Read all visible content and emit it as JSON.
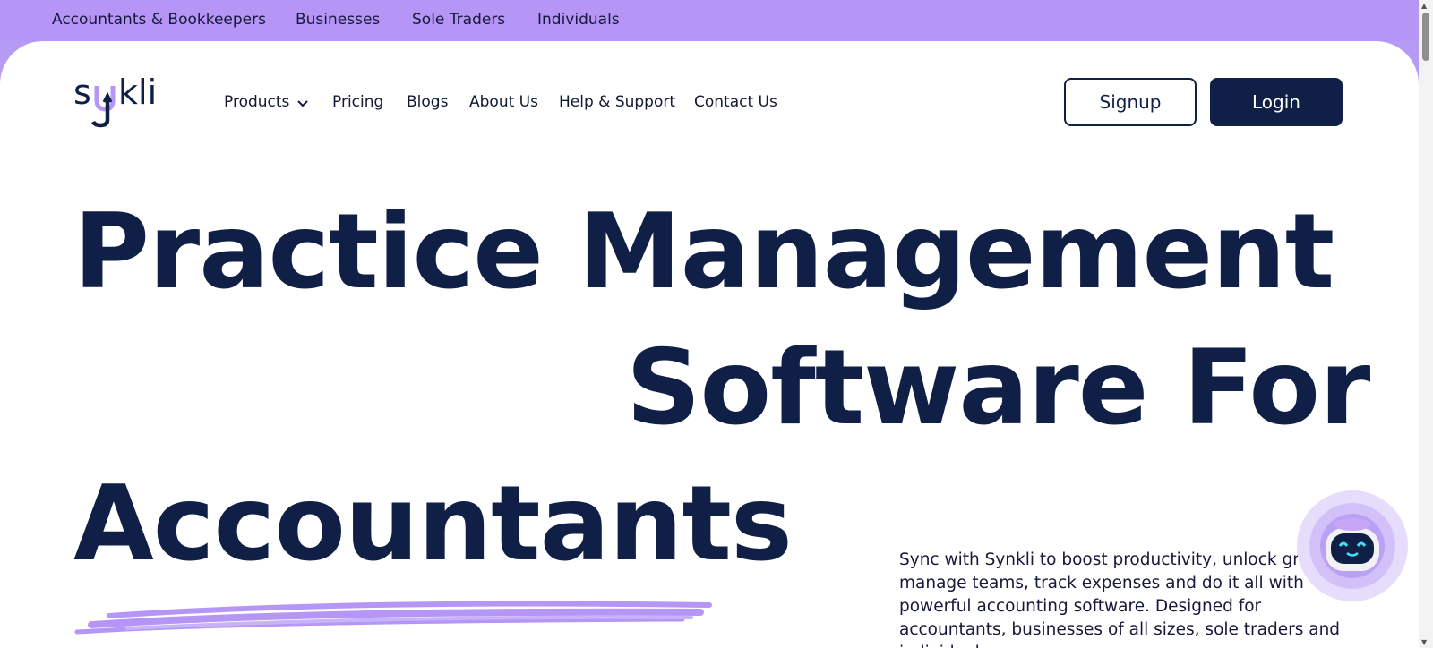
{
  "topbar": {
    "links": [
      "Accountants & Bookkeepers",
      "Businesses",
      "Sole Traders",
      "Individuals"
    ]
  },
  "header": {
    "logo_text": "synkli",
    "nav": [
      "Products",
      "Pricing",
      "Blogs",
      "About Us",
      "Help & Support",
      "Contact Us"
    ],
    "signup_label": "Signup",
    "login_label": "Login"
  },
  "hero": {
    "line1": "Practice Management",
    "line2": "Software For",
    "line3": "Accountants",
    "description": "Sync with Synkli to boost productivity, unlock growth, manage teams, track expenses and do it all with powerful accounting software. Designed for accountants, businesses of all sizes, sole traders and individuals."
  },
  "colors": {
    "brand_purple": "#b596f6",
    "navy": "#0f1f45",
    "white": "#ffffff"
  },
  "icons": [
    "chevron-down-icon",
    "chat-bot-icon"
  ]
}
